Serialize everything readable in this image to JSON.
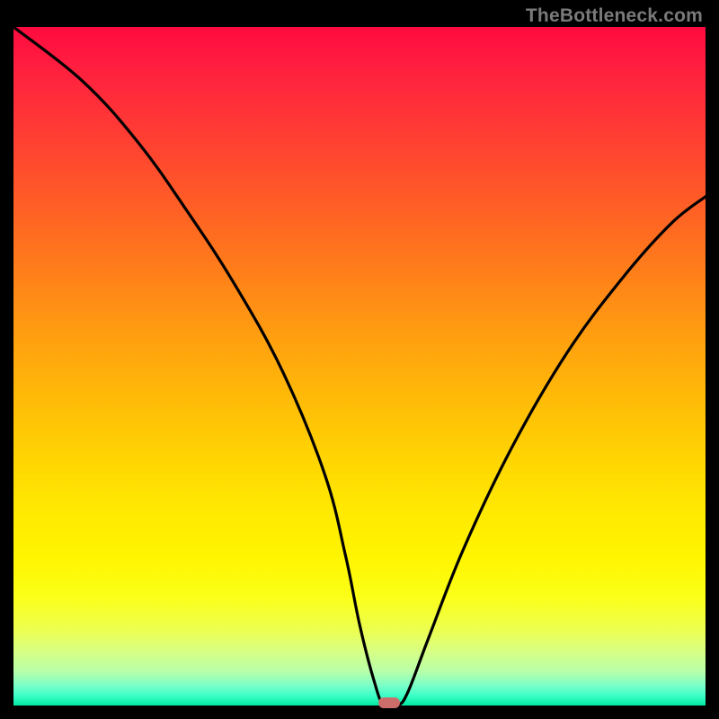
{
  "watermark": "TheBottleneck.com",
  "chart_data": {
    "type": "line",
    "title": "",
    "xlabel": "",
    "ylabel": "",
    "xlim": [
      0,
      100
    ],
    "ylim": [
      0,
      100
    ],
    "series": [
      {
        "name": "bottleneck_curve",
        "x": [
          0,
          10,
          18,
          25,
          32,
          39,
          45,
          48,
          50,
          52,
          53.5,
          55.5,
          57,
          60,
          65,
          72,
          80,
          88,
          95,
          100
        ],
        "values": [
          100,
          92,
          83,
          73,
          62,
          49,
          34,
          22,
          12,
          4,
          0,
          0,
          2,
          10,
          23,
          38,
          52,
          63,
          71,
          75
        ]
      }
    ],
    "marker": {
      "x": 54.3,
      "y": 0,
      "color": "#cb6e6b"
    },
    "gradient_stops": [
      {
        "pos": 0,
        "color": "#ff0b3f"
      },
      {
        "pos": 30,
        "color": "#ff6a21"
      },
      {
        "pos": 62,
        "color": "#ffd003"
      },
      {
        "pos": 84,
        "color": "#fbff18"
      },
      {
        "pos": 100,
        "color": "#00eaa2"
      }
    ]
  }
}
